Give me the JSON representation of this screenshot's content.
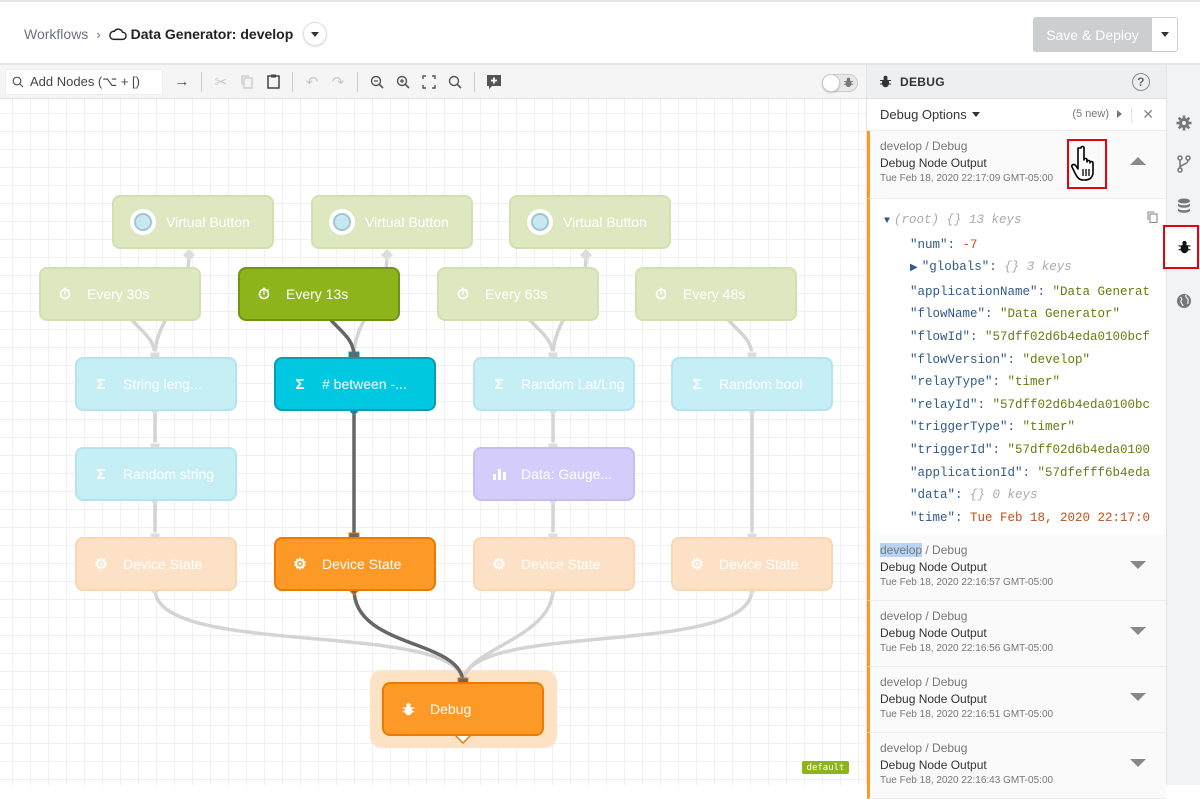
{
  "header": {
    "breadcrumb_root": "Workflows",
    "breadcrumb_sep": "›",
    "workflow_title": "Data Generator: develop",
    "deploy_label": "Save & Deploy"
  },
  "toolbar": {
    "add_nodes_placeholder": "Add Nodes (⌥ + [)",
    "icons": [
      "arrow-right-icon",
      "cut-icon",
      "copy-icon",
      "paste-icon",
      "undo-icon",
      "redo-icon",
      "zoom-out-icon",
      "zoom-in-icon",
      "fit-icon",
      "zoom-reset-icon",
      "add-comment-icon"
    ],
    "debug_toggle_on": false
  },
  "canvas": {
    "nodes": [
      {
        "id": "vb1",
        "label": "Virtual Button",
        "type": "virtual-button",
        "color": "green",
        "faded": true
      },
      {
        "id": "vb2",
        "label": "Virtual Button",
        "type": "virtual-button",
        "color": "green",
        "faded": true
      },
      {
        "id": "vb3",
        "label": "Virtual Button",
        "type": "virtual-button",
        "color": "green",
        "faded": true
      },
      {
        "id": "t30",
        "label": "Every 30s",
        "type": "timer",
        "color": "green",
        "faded": true
      },
      {
        "id": "t13",
        "label": "Every 13s",
        "type": "timer",
        "color": "green",
        "faded": false
      },
      {
        "id": "t63",
        "label": "Every 63s",
        "type": "timer",
        "color": "green",
        "faded": true
      },
      {
        "id": "t48",
        "label": "Every 48s",
        "type": "timer",
        "color": "green",
        "faded": true
      },
      {
        "id": "strlen",
        "label": "String leng...",
        "type": "math",
        "color": "cyan",
        "faded": true
      },
      {
        "id": "between",
        "label": "# between -...",
        "type": "math",
        "color": "cyan",
        "faded": false
      },
      {
        "id": "latlng",
        "label": "Random Lat/Lng",
        "type": "math",
        "color": "cyan",
        "faded": true
      },
      {
        "id": "bool",
        "label": "Random bool",
        "type": "math",
        "color": "cyan",
        "faded": true
      },
      {
        "id": "rstr",
        "label": "Random string",
        "type": "math",
        "color": "cyan",
        "faded": true
      },
      {
        "id": "gauge",
        "label": "Data: Gauge...",
        "type": "data",
        "color": "purple",
        "faded": true
      },
      {
        "id": "ds1",
        "label": "Device State",
        "type": "device-state",
        "color": "orange",
        "faded": true
      },
      {
        "id": "ds2",
        "label": "Device State",
        "type": "device-state",
        "color": "orange",
        "faded": false
      },
      {
        "id": "ds3",
        "label": "Device State",
        "type": "device-state",
        "color": "orange",
        "faded": true
      },
      {
        "id": "ds4",
        "label": "Device State",
        "type": "device-state",
        "color": "orange",
        "faded": true
      },
      {
        "id": "debug",
        "label": "Debug",
        "type": "debug",
        "color": "orange",
        "faded": false
      }
    ],
    "default_badge": "default"
  },
  "debug_panel": {
    "title": "DEBUG",
    "options_label": "Debug Options",
    "new_count": "(5 new)",
    "expanded_entry": {
      "path": "develop / Debug",
      "title": "Debug Node Output",
      "time": "Tue Feb 18, 2020 22:17:09 GMT-05:00",
      "json": {
        "root": "(root)",
        "root_meta": "{}  13 keys",
        "lines": [
          {
            "key": "\"num\"",
            "value": "-7",
            "kind": "n"
          },
          {
            "key": "\"globals\"",
            "value": "{}  3 keys",
            "kind": "m",
            "collapsible": true
          },
          {
            "key": "\"applicationName\"",
            "value": "\"Data Generat",
            "kind": "s"
          },
          {
            "key": "\"flowName\"",
            "value": "\"Data Generator\"",
            "kind": "s"
          },
          {
            "key": "\"flowId\"",
            "value": "\"57dff02d6b4eda0100bcf",
            "kind": "s"
          },
          {
            "key": "\"flowVersion\"",
            "value": "\"develop\"",
            "kind": "s"
          },
          {
            "key": "\"relayType\"",
            "value": "\"timer\"",
            "kind": "s"
          },
          {
            "key": "\"relayId\"",
            "value": "\"57dff02d6b4eda0100bc",
            "kind": "s"
          },
          {
            "key": "\"triggerType\"",
            "value": "\"timer\"",
            "kind": "s"
          },
          {
            "key": "\"triggerId\"",
            "value": "\"57dff02d6b4eda0100",
            "kind": "s"
          },
          {
            "key": "\"applicationId\"",
            "value": "\"57dfefff6b4eda",
            "kind": "s"
          },
          {
            "key": "\"data\"",
            "value": "{}  0 keys",
            "kind": "m"
          },
          {
            "key": "\"time\"",
            "value": "Tue Feb 18, 2020 22:17:0",
            "kind": "n"
          }
        ]
      }
    },
    "entries": [
      {
        "path_highlight": "develop",
        "path_rest": " / Debug",
        "title": "Debug Node Output",
        "time": "Tue Feb 18, 2020 22:16:57 GMT-05:00"
      },
      {
        "path_highlight": "",
        "path_rest": "develop / Debug",
        "title": "Debug Node Output",
        "time": "Tue Feb 18, 2020 22:16:56 GMT-05:00"
      },
      {
        "path_highlight": "",
        "path_rest": "develop / Debug",
        "title": "Debug Node Output",
        "time": "Tue Feb 18, 2020 22:16:51 GMT-05:00"
      },
      {
        "path_highlight": "",
        "path_rest": "develop / Debug",
        "title": "Debug Node Output",
        "time": "Tue Feb 18, 2020 22:16:43 GMT-05:00"
      }
    ]
  },
  "rail": {
    "items": [
      "settings",
      "versions",
      "storage",
      "debug",
      "globals"
    ],
    "active": "debug"
  },
  "colors": {
    "trigger_green": "#8db51b",
    "math_cyan": "#00c8e0",
    "output_orange": "#fd9927",
    "data_purple": "#d4ccfb",
    "highlight_red": "#e8000b"
  }
}
